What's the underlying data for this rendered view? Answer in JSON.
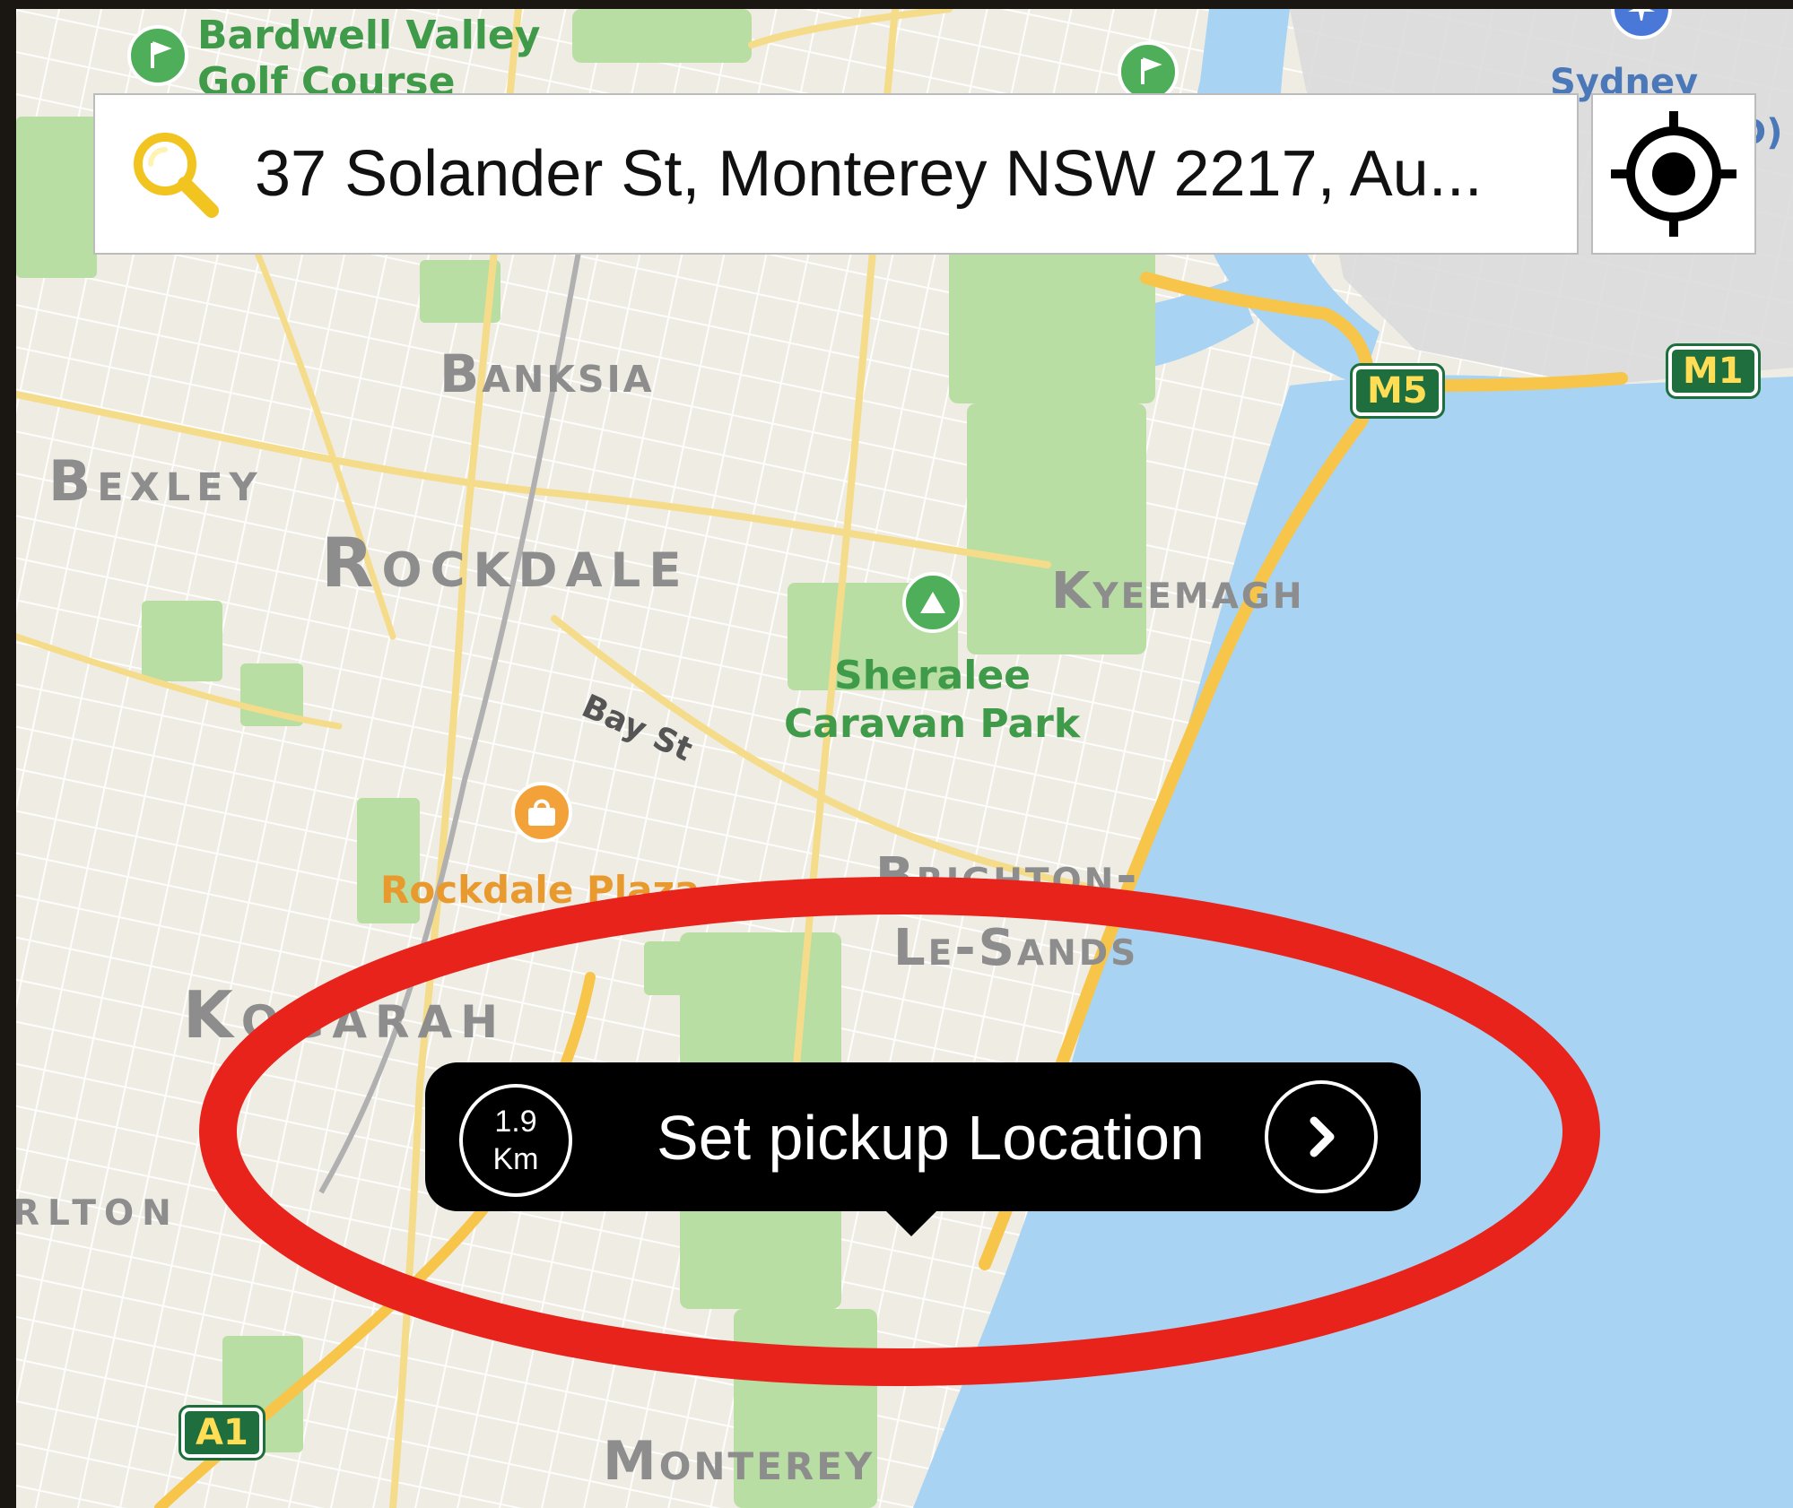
{
  "search": {
    "address": "37 Solander St, Monterey NSW 2217, Au...",
    "icon": "search-icon"
  },
  "locate": {
    "icon": "crosshair-icon"
  },
  "map": {
    "suburbs": {
      "banksia": "Banksia",
      "bexley": "Bexley",
      "rockdale": "Rockdale",
      "kyeemagh": "Kyeemagh",
      "brighton_1": "Brighton-",
      "brighton_2": "Le-Sands",
      "kogarah": "Kogarah",
      "carlton": "rlton",
      "monterey": "Monterey"
    },
    "parks": {
      "golf_1": "Bardwell Valley",
      "golf_2": "Golf Course",
      "sheralee_1": "Sheralee",
      "sheralee_2": "Caravan Park"
    },
    "pois": {
      "rockdale_plaza": "Rockdale Plaza",
      "sydney": "Sydney",
      "airport_suffix": "D)"
    },
    "roads": {
      "bay_st": "Bay St"
    },
    "shields": {
      "m5": "M5",
      "m1": "M1",
      "a1": "A1"
    },
    "colors": {
      "land": "#efece4",
      "water": "#a9d3f2",
      "park": "#b9dea3",
      "major_road": "#f7c54a",
      "highlight": "#e8231b"
    }
  },
  "pickup": {
    "distance_value": "1.9",
    "distance_unit": "Km",
    "label": "Set pickup Location",
    "arrow_icon": "chevron-right-icon"
  }
}
